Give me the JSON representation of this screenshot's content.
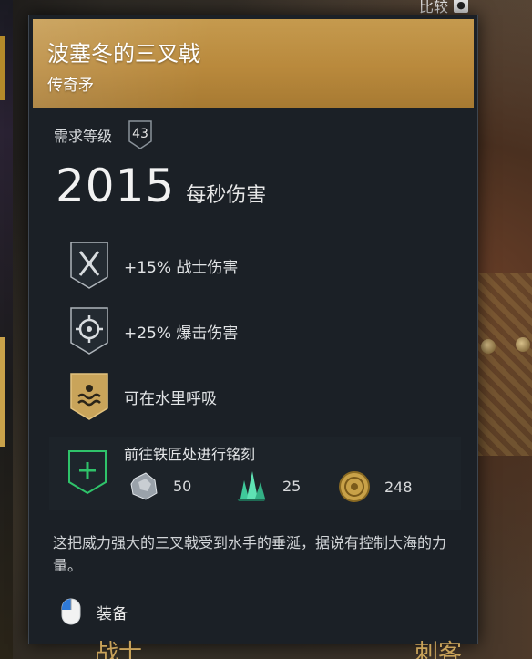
{
  "top": {
    "compare_label": "比较"
  },
  "item": {
    "name": "波塞冬的三叉戟",
    "rarity": "传奇矛",
    "level_label": "需求等级",
    "level_value": "43",
    "dps_value": "2015",
    "dps_label": "每秒伤害"
  },
  "perks": [
    {
      "icon": "crossed-swords-icon",
      "text": "+15% 战士伤害"
    },
    {
      "icon": "crosshair-icon",
      "text": "+25% 爆击伤害"
    },
    {
      "icon": "water-waves-icon",
      "text": "可在水里呼吸"
    }
  ],
  "engrave": {
    "title": "前往铁匠处进行铭刻",
    "materials": [
      {
        "icon": "iron-ore-icon",
        "amount": "50"
      },
      {
        "icon": "crystal-icon",
        "amount": "25"
      },
      {
        "icon": "coin-icon",
        "amount": "248"
      }
    ]
  },
  "description": "这把威力强大的三叉戟受到水手的垂涎，据说有控制大海的力量。",
  "equip_label": "装备",
  "bottom_tabs": {
    "left": "战士",
    "right": "刺客"
  },
  "colors": {
    "header_gold": "#b9893c",
    "panel_bg": "#1b2026",
    "engrave_green": "#2fc36a"
  }
}
